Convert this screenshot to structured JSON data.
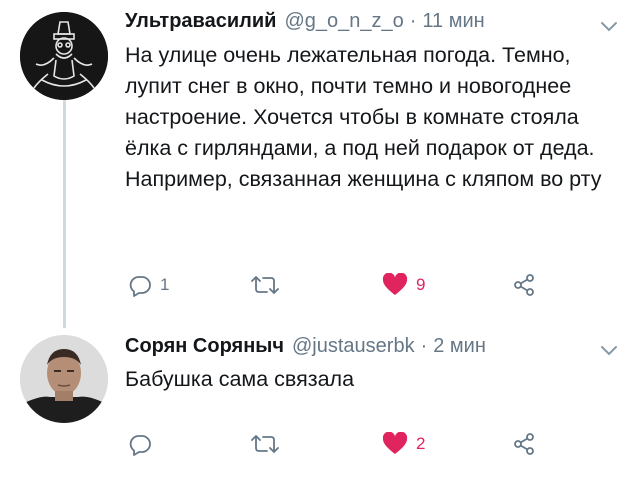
{
  "tweets": [
    {
      "name": "Ультравасилий",
      "handle": "@g_o_n_z_o",
      "separator": "·",
      "time": "11 мин",
      "text": "На улице очень лежательная погода. Темно, лупит снег в окно, почти темно и новогоднее настроение. Хочется чтобы в комнате стояла ёлка с гирляндами, а под ней подарок от деда. Например, связанная женщина с кляпом во рту",
      "replies": "1",
      "retweets": "",
      "likes": "9",
      "liked": true
    },
    {
      "name": "Сорян Соряныч",
      "handle": "@justauserbk",
      "separator": "·",
      "time": "2 мин",
      "text": "Бабушка сама связала",
      "replies": "",
      "retweets": "",
      "likes": "2",
      "liked": true
    }
  ],
  "colors": {
    "text": "#14171a",
    "secondary": "#657786",
    "like": "#e0245e",
    "thread_line": "#cfd9de"
  },
  "icons": [
    "reply-icon",
    "retweet-icon",
    "heart-icon",
    "share-icon",
    "chevron-down-icon"
  ]
}
